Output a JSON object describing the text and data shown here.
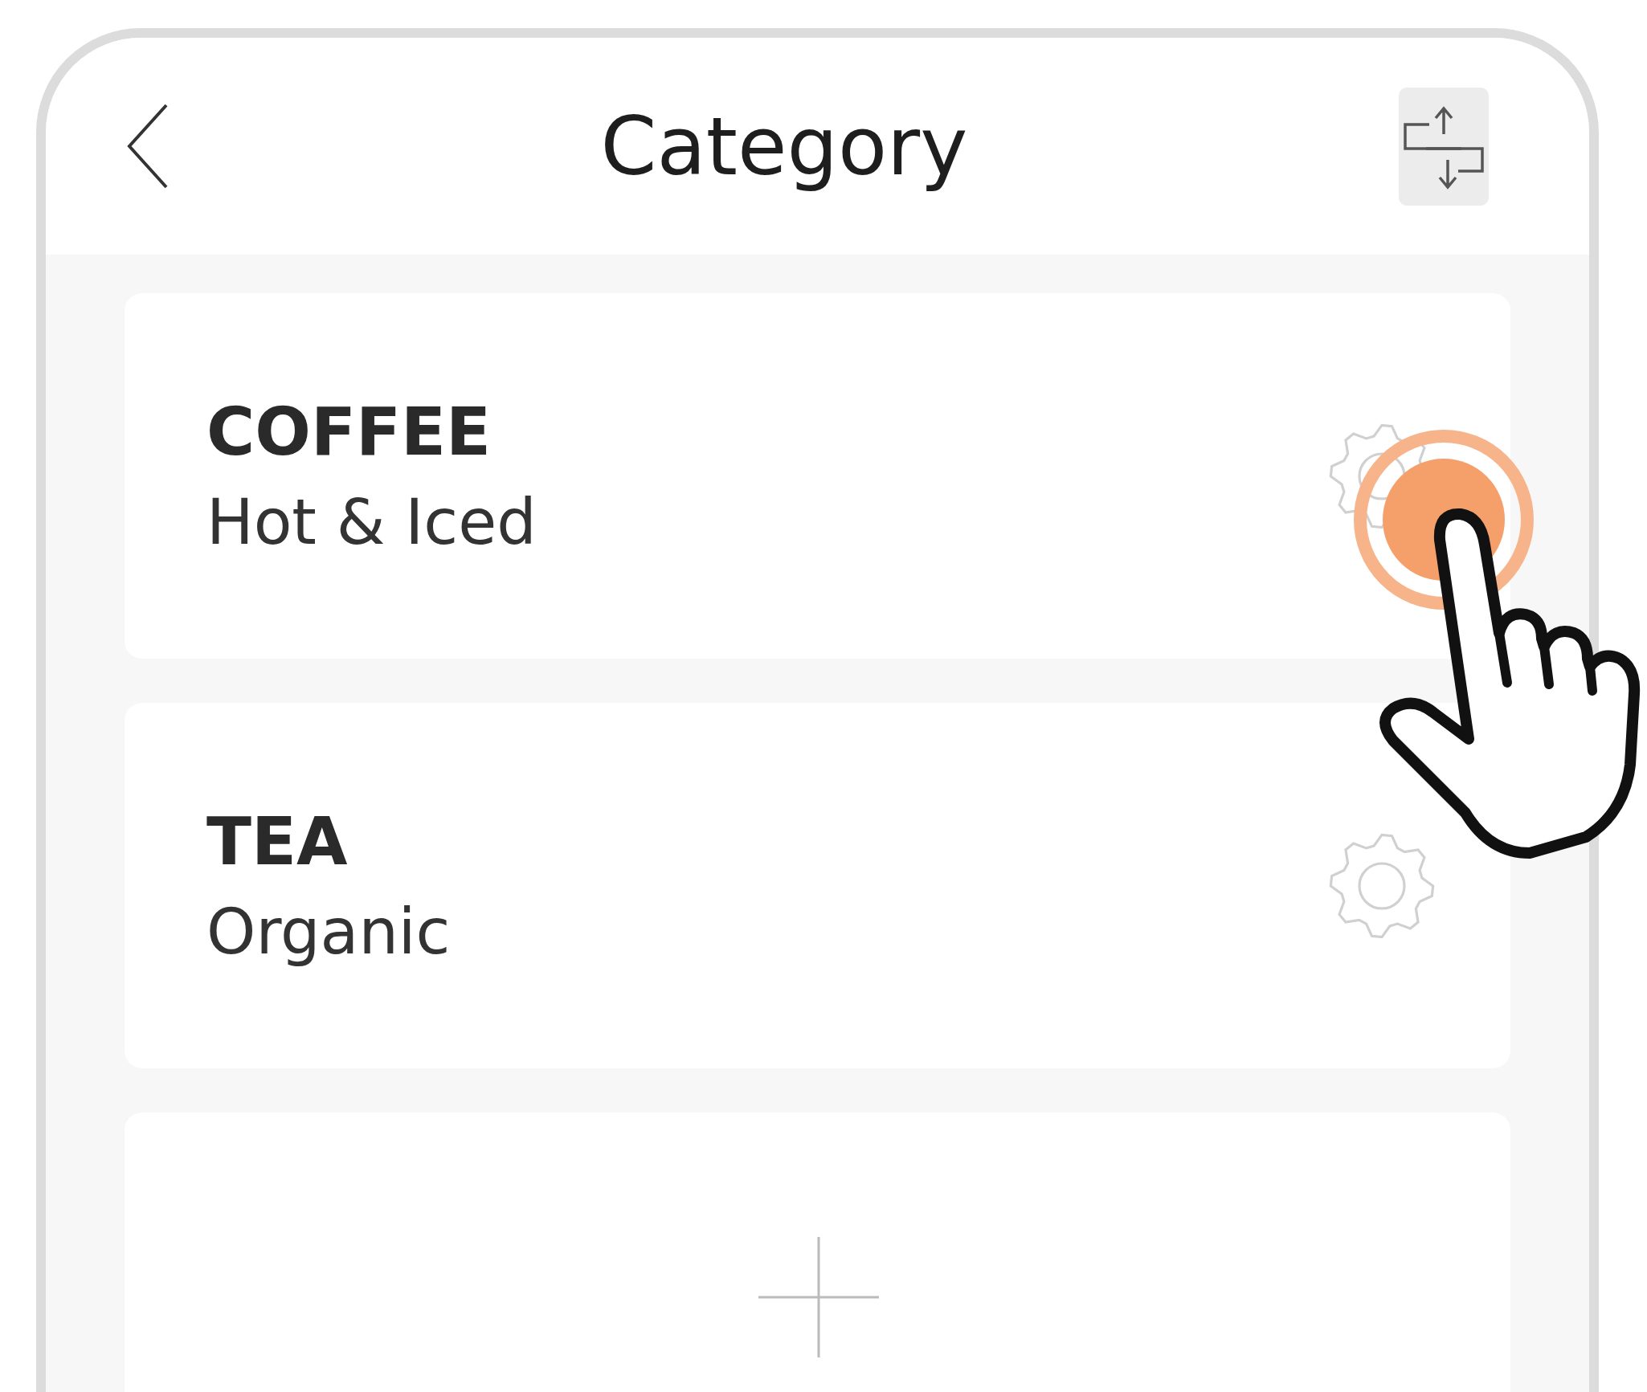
{
  "header": {
    "title": "Category"
  },
  "categories": [
    {
      "title": "COFFEE",
      "subtitle": "Hot & Iced"
    },
    {
      "title": "TEA",
      "subtitle": "Organic"
    }
  ]
}
